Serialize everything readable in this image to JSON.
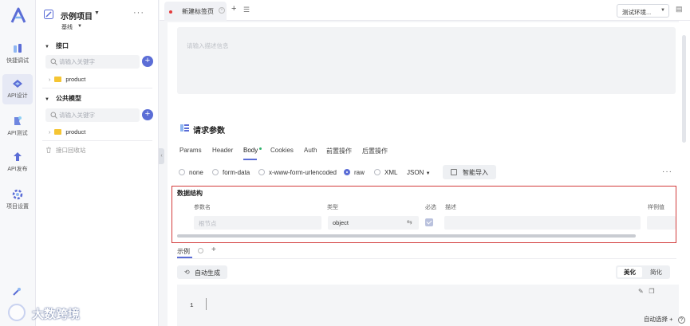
{
  "rail": {
    "items": [
      {
        "label": "快捷调试",
        "icon": "quick-debug-icon"
      },
      {
        "label": "API设计",
        "icon": "api-design-icon",
        "active": true
      },
      {
        "label": "API测试",
        "icon": "api-test-icon"
      },
      {
        "label": "API发布",
        "icon": "api-publish-icon"
      },
      {
        "label": "项目设置",
        "icon": "project-settings-icon"
      }
    ]
  },
  "sidebar": {
    "project_name": "示例项目",
    "branch": "基线",
    "more": "···",
    "sections": [
      {
        "title": "接口",
        "search_placeholder": "请输入关键字",
        "items": [
          {
            "label": "product"
          }
        ]
      },
      {
        "title": "公共模型",
        "search_placeholder": "请输入关键字",
        "items": [
          {
            "label": "product"
          }
        ]
      }
    ],
    "recycle_label": "接口回收站"
  },
  "tabs": {
    "items": [
      {
        "label": "新建标签页"
      }
    ],
    "add": "+",
    "env_select": "测试环境..."
  },
  "description": {
    "placeholder": "请输入描述信息"
  },
  "request_params": {
    "title": "请求参数",
    "tabs": [
      "Params",
      "Header",
      "Body",
      "Cookies",
      "Auth",
      "前置操作",
      "后置操作"
    ],
    "active_tab": "Body",
    "body_types": [
      "none",
      "form-data",
      "x-www-form-urlencoded",
      "raw",
      "XML"
    ],
    "selected_body_type": "raw",
    "format": "JSON",
    "smart_import": "智能导入",
    "more": "···"
  },
  "data_structure": {
    "title": "数据结构",
    "columns": [
      "参数名",
      "类型",
      "必选",
      "描述",
      "样例值"
    ],
    "row": {
      "name_placeholder": "根节点",
      "type": "object",
      "required": true
    }
  },
  "example": {
    "tab": "示例",
    "add": "+",
    "auto_generate": "自动生成",
    "beautify": "美化",
    "compact": "简化",
    "line_number": "1"
  },
  "footer": {
    "auto_select": "自动选择",
    "add": "+",
    "help": "?"
  },
  "watermark": {
    "text": "大数跨境"
  },
  "colors": {
    "accent": "#5b6dd6",
    "highlight_border": "#d23b3b",
    "tab_dot": "#e33b3b",
    "folder": "#f5c533"
  }
}
